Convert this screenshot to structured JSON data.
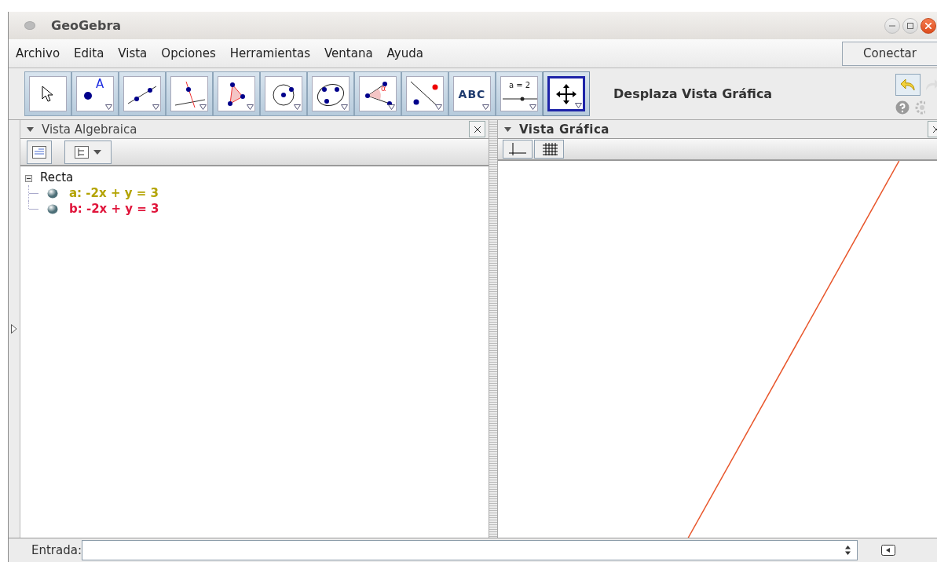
{
  "window": {
    "title": "GeoGebra"
  },
  "menu": [
    "Archivo",
    "Edita",
    "Vista",
    "Opciones",
    "Herramientas",
    "Ventana",
    "Ayuda"
  ],
  "connect_button": "Conectar",
  "tools": [
    {
      "kind": "move",
      "selected": false
    },
    {
      "kind": "point",
      "selected": false,
      "label": "A"
    },
    {
      "kind": "line",
      "selected": false
    },
    {
      "kind": "perpendicular",
      "selected": false
    },
    {
      "kind": "polygon",
      "selected": false
    },
    {
      "kind": "circle",
      "selected": false
    },
    {
      "kind": "conic",
      "selected": false
    },
    {
      "kind": "angle",
      "selected": false,
      "label": "α"
    },
    {
      "kind": "reflect",
      "selected": false
    },
    {
      "kind": "text",
      "selected": false,
      "label": "ABC"
    },
    {
      "kind": "slider",
      "selected": false,
      "label": "a = 2"
    },
    {
      "kind": "pan",
      "selected": true
    }
  ],
  "tool_name": "Desplaza Vista Gráfica",
  "algebra_view": {
    "title": "Vista Algebraica",
    "groups": [
      {
        "label": "Recta",
        "expanded": true,
        "children": [
          {
            "label": "a: -2x + y = 3",
            "color": "#b3a300"
          },
          {
            "label": "b: -2x + y = 3",
            "color": "#e0163c"
          }
        ]
      }
    ]
  },
  "graphics_view": {
    "title": "Vista Gráfica"
  },
  "input_bar": {
    "label": "Entrada:"
  }
}
